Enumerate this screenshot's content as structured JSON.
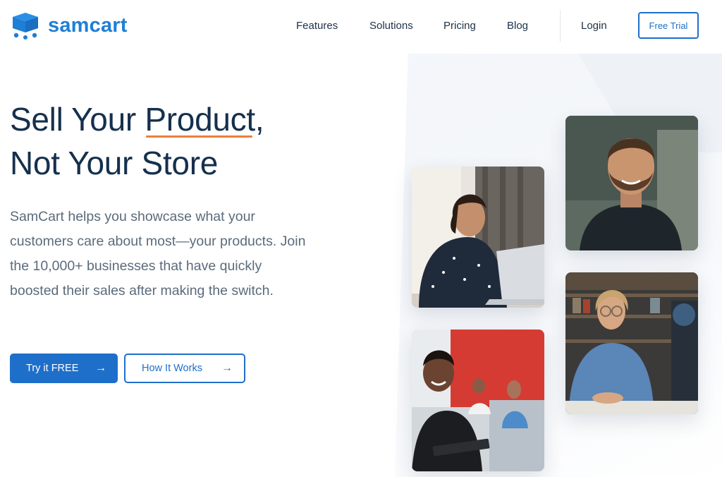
{
  "brand": {
    "name": "samcart",
    "color": "#1e7fd6",
    "icon": "cart-box-icon"
  },
  "nav": {
    "items": [
      "Features",
      "Solutions",
      "Pricing",
      "Blog"
    ],
    "login": "Login",
    "cta": "Free Trial"
  },
  "hero": {
    "headline_part1": "Sell Your ",
    "headline_highlight": "Product",
    "headline_part2": ",",
    "headline_line2": "Not Your Store",
    "subtext": "SamCart helps you showcase what your customers care about most—your products. Join the 10,000+ businesses that have quickly boosted their sales after making the switch.",
    "primary_cta": "Try it FREE",
    "secondary_cta": "How It Works",
    "highlight_color": "#e8803a",
    "accent_color": "#1e6fc9"
  },
  "photos": [
    {
      "subject": "woman-with-laptop"
    },
    {
      "subject": "smiling-bearded-man"
    },
    {
      "subject": "woman-with-tablet-office"
    },
    {
      "subject": "man-with-glasses-studio"
    }
  ]
}
